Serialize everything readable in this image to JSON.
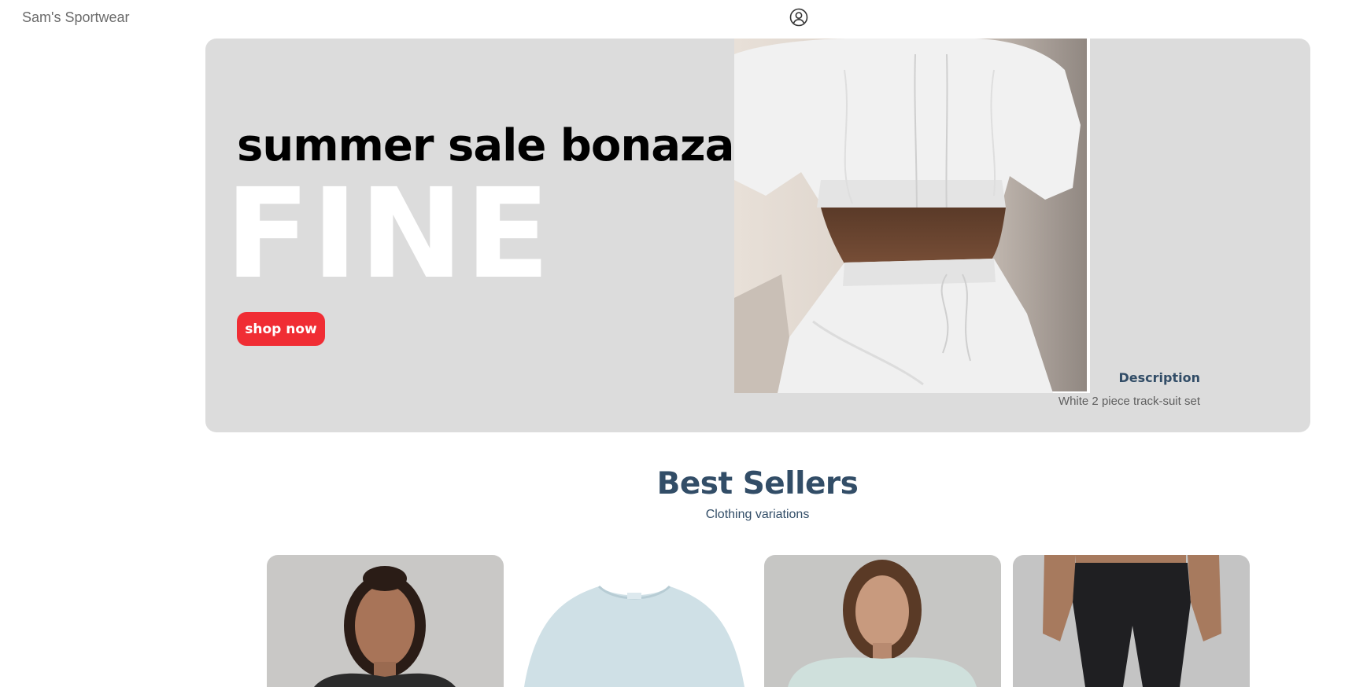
{
  "navbar": {
    "brand": "Sam's Sportwear",
    "user_icon": "user-circle-icon"
  },
  "hero": {
    "small_text": "summer sale bonaza",
    "large_text": "FINE",
    "button_label": "shop now",
    "image_alt": "white two piece tracksuit photo",
    "description_title": "Description",
    "description_text": "White 2 piece track-suit set",
    "colors": {
      "banner_bg": "#dcdcdc",
      "button_bg": "#f02d34",
      "headline": "#000000",
      "large_text": "#ffffff"
    }
  },
  "best_sellers": {
    "title": "Best Sellers",
    "subtitle": "Clothing variations",
    "title_color": "#324d67"
  },
  "products": [
    {
      "image": "woman in black top product photo"
    },
    {
      "image": "light blue t-shirt product photo"
    },
    {
      "image": "woman in mint sweatshirt product photo"
    },
    {
      "image": "black leggings product photo"
    }
  ]
}
